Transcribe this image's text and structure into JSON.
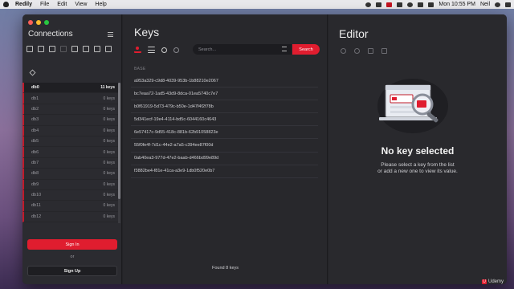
{
  "menubar": {
    "app_name": "Redily",
    "items": [
      "File",
      "Edit",
      "View",
      "Help"
    ],
    "clock": "Mon 10:55 PM",
    "user": "Neil"
  },
  "sidebar": {
    "title": "Connections",
    "databases": [
      {
        "name": "db0",
        "keys": "11 keys"
      },
      {
        "name": "db1",
        "keys": "0 keys"
      },
      {
        "name": "db2",
        "keys": "0 keys"
      },
      {
        "name": "db3",
        "keys": "0 keys"
      },
      {
        "name": "db4",
        "keys": "0 keys"
      },
      {
        "name": "db5",
        "keys": "0 keys"
      },
      {
        "name": "db6",
        "keys": "0 keys"
      },
      {
        "name": "db7",
        "keys": "0 keys"
      },
      {
        "name": "db8",
        "keys": "0 keys"
      },
      {
        "name": "db9",
        "keys": "0 keys"
      },
      {
        "name": "db10",
        "keys": "0 keys"
      },
      {
        "name": "db11",
        "keys": "0 keys"
      },
      {
        "name": "db12",
        "keys": "0 keys"
      }
    ],
    "sign_in_label": "Sign In",
    "or_label": "or",
    "sign_up_label": "Sign Up",
    "scroll_fraction": 0.83
  },
  "keys": {
    "title": "Keys",
    "search_placeholder": "Search...",
    "search_button": "Search",
    "group_label": "BASE",
    "items": [
      "a953a329-c9d8-4039-953b-1b88210e2067",
      "bc7eaa72-1ad5-43d9-8dca-01ea5740c7e7",
      "b0f61919-5d73-479c-b50e-1d47f4f2f78b",
      "5d341ecf-19e4-4114-bd5c-6044160c4643",
      "6e57417c-9d55-418c-881b-62b91058823e",
      "55f0fe4f-7d1c-44e2-a7a5-c394ee87f00d",
      "0ab40ea3-977d-47e2-baab-d466bd99e89d",
      "f3882be4-f81e-41ca-a3e9-1db0f520e0b7"
    ],
    "found_text": "Found 8 keys"
  },
  "editor": {
    "title": "Editor",
    "empty_title": "No key selected",
    "empty_line1": "Please select a key from the list",
    "empty_line2": "or add a new one to view its value."
  },
  "watermark": "Udemy",
  "colors": {
    "accent": "#e01d2f",
    "panel_dark": "#232327",
    "sidebar_bg": "#2b2b30"
  }
}
